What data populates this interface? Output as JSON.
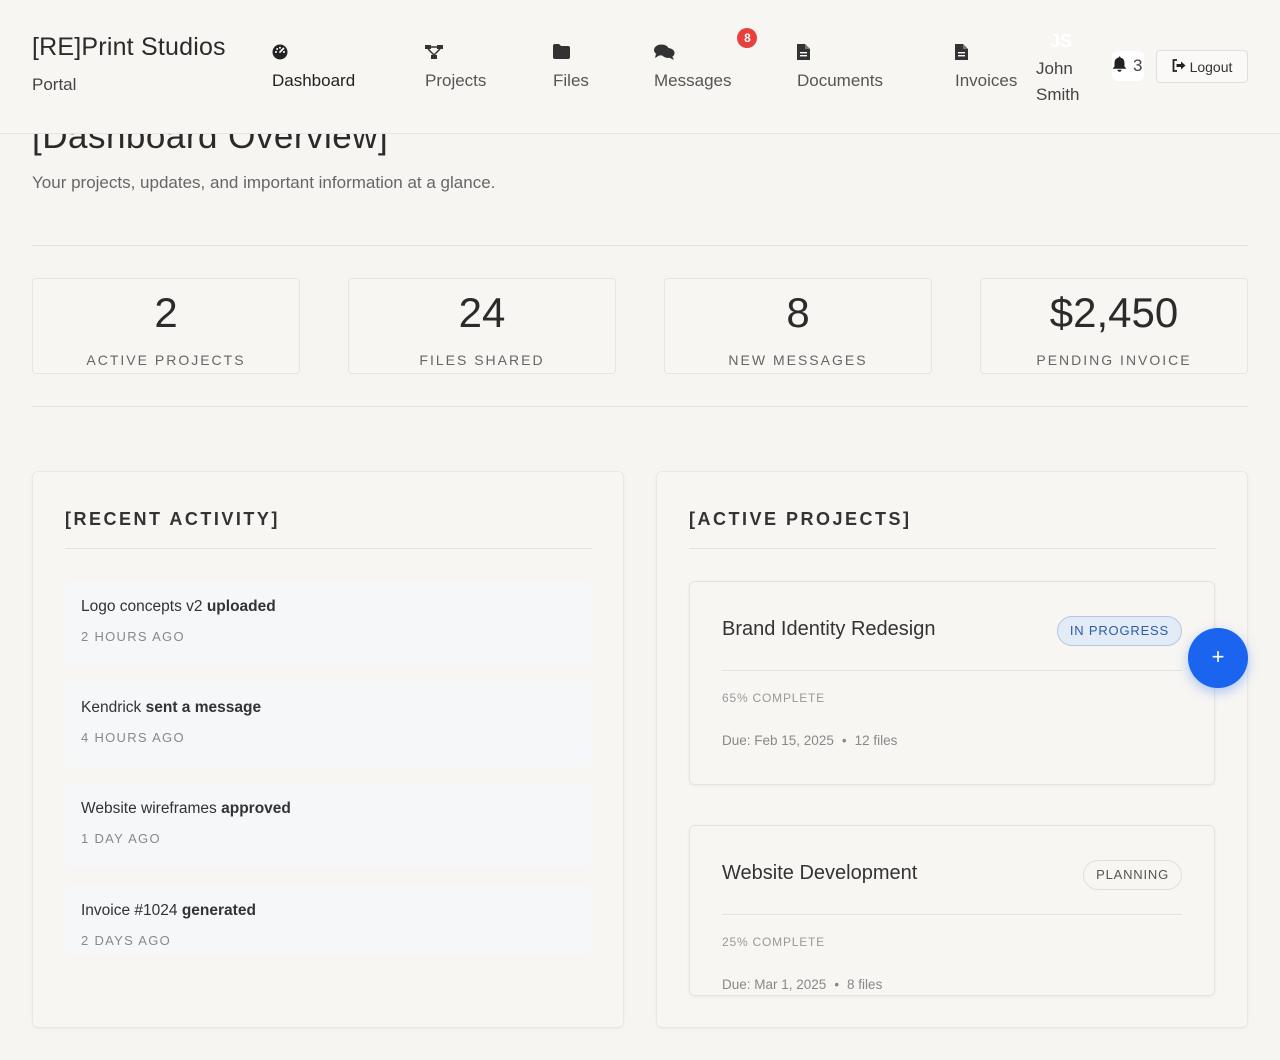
{
  "brand": {
    "name": "[RE]Print Studios",
    "subtitle": "Portal"
  },
  "nav": [
    {
      "label": "Dashboard",
      "icon": "dashboard-icon",
      "active": true
    },
    {
      "label": "Projects",
      "icon": "projects-icon"
    },
    {
      "label": "Files",
      "icon": "folder-icon"
    },
    {
      "label": "Messages",
      "icon": "messages-icon",
      "badge": "8"
    },
    {
      "label": "Documents",
      "icon": "document-icon"
    },
    {
      "label": "Invoices",
      "icon": "invoice-icon"
    }
  ],
  "user": {
    "initials": "JS",
    "name": "John Smith"
  },
  "notifications": {
    "count": "3",
    "icon": "bell-icon"
  },
  "logout": {
    "label": "Logout",
    "icon": "logout-icon"
  },
  "page": {
    "title": "[Dashboard Overview]",
    "subtitle": "Your projects, updates, and important information at a glance."
  },
  "stats": [
    {
      "value": "2",
      "label": "ACTIVE PROJECTS"
    },
    {
      "value": "24",
      "label": "FILES SHARED"
    },
    {
      "value": "8",
      "label": "NEW MESSAGES"
    },
    {
      "value": "$2,450",
      "label": "PENDING INVOICE"
    }
  ],
  "recent_activity": {
    "title": "[RECENT ACTIVITY]",
    "items": [
      {
        "subject": "Logo concepts v2",
        "action": "uploaded",
        "time": "2 HOURS AGO"
      },
      {
        "subject": "Kendrick",
        "action": "sent a message",
        "time": "4 HOURS AGO"
      },
      {
        "subject": "Website wireframes",
        "action": "approved",
        "time": "1 DAY AGO"
      },
      {
        "subject": "Invoice #1024",
        "action": "generated",
        "time": "2 DAYS AGO"
      }
    ]
  },
  "active_projects": {
    "title": "[ACTIVE PROJECTS]",
    "items": [
      {
        "name": "Brand Identity Redesign",
        "status": "IN PROGRESS",
        "progress": "65% COMPLETE",
        "due": "Due: Feb 15, 2025",
        "files": "12 files"
      },
      {
        "name": "Website Development",
        "status": "PLANNING",
        "progress": "25% COMPLETE",
        "due": "Due: Mar 1, 2025",
        "files": "8 files"
      }
    ]
  },
  "fab": {
    "label": "+"
  },
  "colors": {
    "accent": "#1a64ef",
    "badge": "#e8403e",
    "status_in_progress": "#2a5caa",
    "background": "#f7f5f2"
  }
}
